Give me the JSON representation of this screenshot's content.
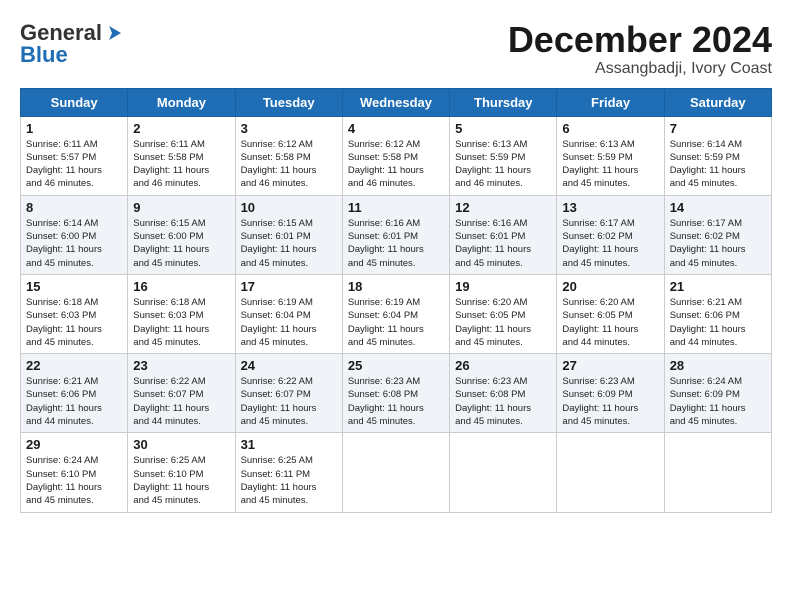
{
  "header": {
    "logo_general": "General",
    "logo_blue": "Blue",
    "month": "December 2024",
    "location": "Assangbadji, Ivory Coast"
  },
  "weekdays": [
    "Sunday",
    "Monday",
    "Tuesday",
    "Wednesday",
    "Thursday",
    "Friday",
    "Saturday"
  ],
  "weeks": [
    [
      {
        "day": "1",
        "sunrise": "6:11 AM",
        "sunset": "5:57 PM",
        "daylight": "11 hours and 46 minutes."
      },
      {
        "day": "2",
        "sunrise": "6:11 AM",
        "sunset": "5:58 PM",
        "daylight": "11 hours and 46 minutes."
      },
      {
        "day": "3",
        "sunrise": "6:12 AM",
        "sunset": "5:58 PM",
        "daylight": "11 hours and 46 minutes."
      },
      {
        "day": "4",
        "sunrise": "6:12 AM",
        "sunset": "5:58 PM",
        "daylight": "11 hours and 46 minutes."
      },
      {
        "day": "5",
        "sunrise": "6:13 AM",
        "sunset": "5:59 PM",
        "daylight": "11 hours and 46 minutes."
      },
      {
        "day": "6",
        "sunrise": "6:13 AM",
        "sunset": "5:59 PM",
        "daylight": "11 hours and 45 minutes."
      },
      {
        "day": "7",
        "sunrise": "6:14 AM",
        "sunset": "5:59 PM",
        "daylight": "11 hours and 45 minutes."
      }
    ],
    [
      {
        "day": "8",
        "sunrise": "6:14 AM",
        "sunset": "6:00 PM",
        "daylight": "11 hours and 45 minutes."
      },
      {
        "day": "9",
        "sunrise": "6:15 AM",
        "sunset": "6:00 PM",
        "daylight": "11 hours and 45 minutes."
      },
      {
        "day": "10",
        "sunrise": "6:15 AM",
        "sunset": "6:01 PM",
        "daylight": "11 hours and 45 minutes."
      },
      {
        "day": "11",
        "sunrise": "6:16 AM",
        "sunset": "6:01 PM",
        "daylight": "11 hours and 45 minutes."
      },
      {
        "day": "12",
        "sunrise": "6:16 AM",
        "sunset": "6:01 PM",
        "daylight": "11 hours and 45 minutes."
      },
      {
        "day": "13",
        "sunrise": "6:17 AM",
        "sunset": "6:02 PM",
        "daylight": "11 hours and 45 minutes."
      },
      {
        "day": "14",
        "sunrise": "6:17 AM",
        "sunset": "6:02 PM",
        "daylight": "11 hours and 45 minutes."
      }
    ],
    [
      {
        "day": "15",
        "sunrise": "6:18 AM",
        "sunset": "6:03 PM",
        "daylight": "11 hours and 45 minutes."
      },
      {
        "day": "16",
        "sunrise": "6:18 AM",
        "sunset": "6:03 PM",
        "daylight": "11 hours and 45 minutes."
      },
      {
        "day": "17",
        "sunrise": "6:19 AM",
        "sunset": "6:04 PM",
        "daylight": "11 hours and 45 minutes."
      },
      {
        "day": "18",
        "sunrise": "6:19 AM",
        "sunset": "6:04 PM",
        "daylight": "11 hours and 45 minutes."
      },
      {
        "day": "19",
        "sunrise": "6:20 AM",
        "sunset": "6:05 PM",
        "daylight": "11 hours and 45 minutes."
      },
      {
        "day": "20",
        "sunrise": "6:20 AM",
        "sunset": "6:05 PM",
        "daylight": "11 hours and 44 minutes."
      },
      {
        "day": "21",
        "sunrise": "6:21 AM",
        "sunset": "6:06 PM",
        "daylight": "11 hours and 44 minutes."
      }
    ],
    [
      {
        "day": "22",
        "sunrise": "6:21 AM",
        "sunset": "6:06 PM",
        "daylight": "11 hours and 44 minutes."
      },
      {
        "day": "23",
        "sunrise": "6:22 AM",
        "sunset": "6:07 PM",
        "daylight": "11 hours and 44 minutes."
      },
      {
        "day": "24",
        "sunrise": "6:22 AM",
        "sunset": "6:07 PM",
        "daylight": "11 hours and 45 minutes."
      },
      {
        "day": "25",
        "sunrise": "6:23 AM",
        "sunset": "6:08 PM",
        "daylight": "11 hours and 45 minutes."
      },
      {
        "day": "26",
        "sunrise": "6:23 AM",
        "sunset": "6:08 PM",
        "daylight": "11 hours and 45 minutes."
      },
      {
        "day": "27",
        "sunrise": "6:23 AM",
        "sunset": "6:09 PM",
        "daylight": "11 hours and 45 minutes."
      },
      {
        "day": "28",
        "sunrise": "6:24 AM",
        "sunset": "6:09 PM",
        "daylight": "11 hours and 45 minutes."
      }
    ],
    [
      {
        "day": "29",
        "sunrise": "6:24 AM",
        "sunset": "6:10 PM",
        "daylight": "11 hours and 45 minutes."
      },
      {
        "day": "30",
        "sunrise": "6:25 AM",
        "sunset": "6:10 PM",
        "daylight": "11 hours and 45 minutes."
      },
      {
        "day": "31",
        "sunrise": "6:25 AM",
        "sunset": "6:11 PM",
        "daylight": "11 hours and 45 minutes."
      },
      null,
      null,
      null,
      null
    ]
  ]
}
